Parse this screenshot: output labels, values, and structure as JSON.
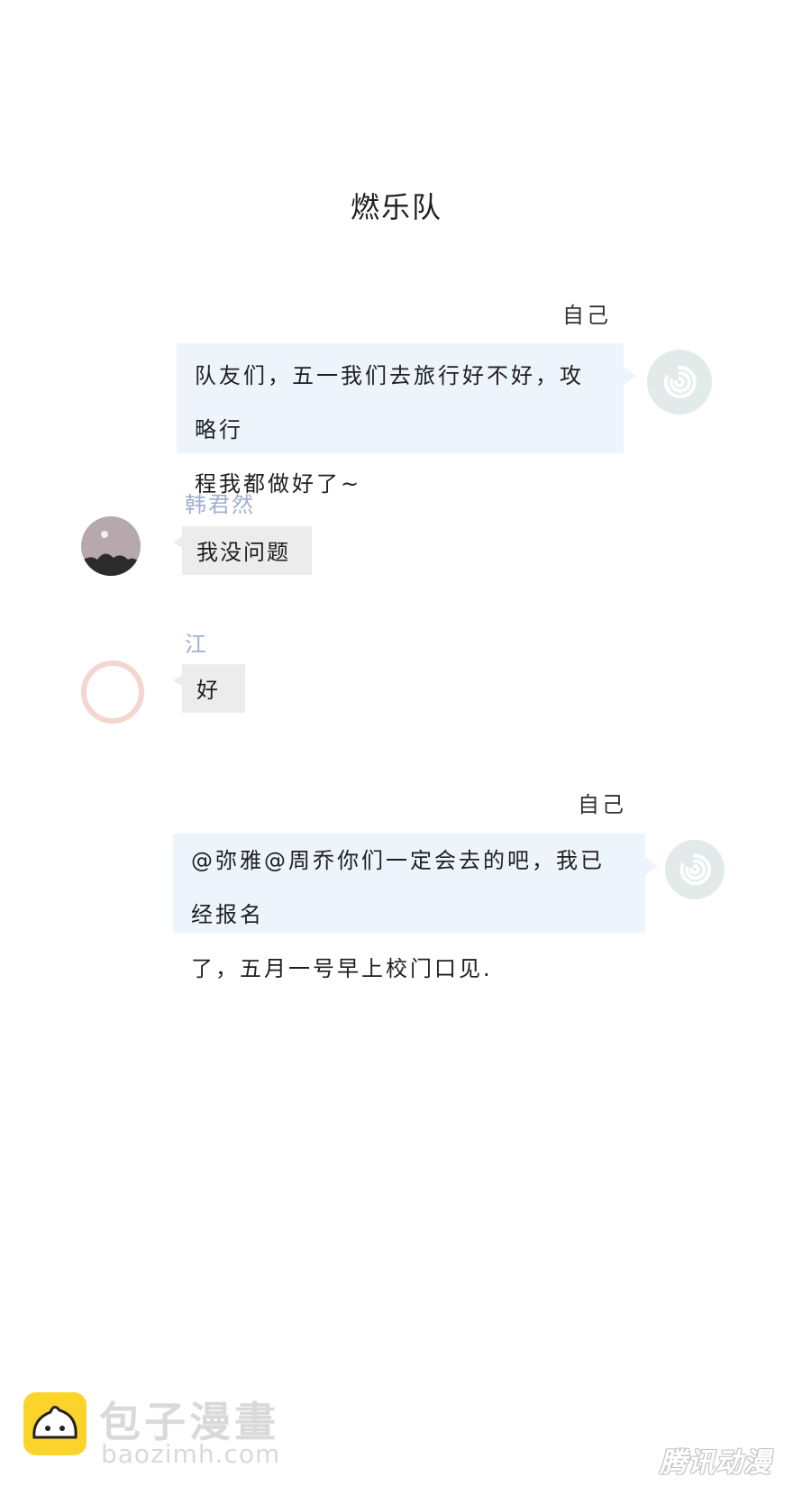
{
  "chat": {
    "title": "燃乐队",
    "messages": [
      {
        "sender": "自己",
        "lines": [
          "队友们，五一我们去旅行好不好，攻略行",
          "程我都做好了~"
        ]
      },
      {
        "sender": "韩君然",
        "text": "我没问题"
      },
      {
        "sender": "江",
        "text": "好"
      },
      {
        "sender": "自己",
        "lines": [
          "@弥雅@周乔你们一定会去的吧，我已经报名",
          "了，五月一号早上校门口见."
        ]
      }
    ]
  },
  "watermark": {
    "site_name": "包子漫畫",
    "site_domain": "baozimh.com",
    "brand": "腾讯动漫"
  },
  "colors": {
    "self_bubble": "#edf4fb",
    "other_bubble": "#ececec",
    "sender_name": "#9fb0cf",
    "logo": "#fcd32a"
  }
}
